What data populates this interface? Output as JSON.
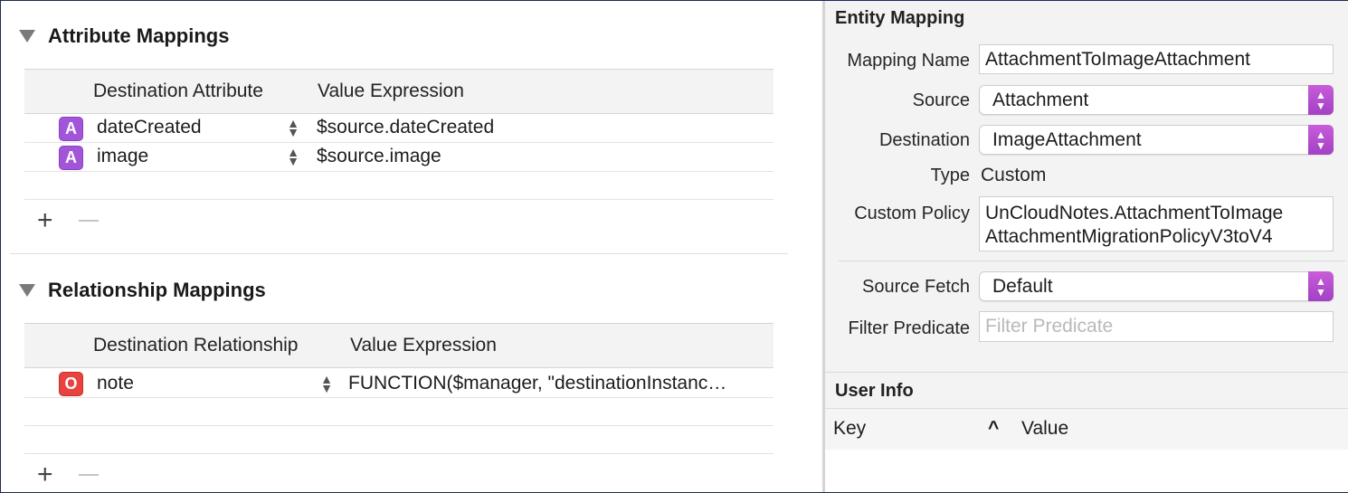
{
  "attribute_mappings": {
    "title": "Attribute Mappings",
    "columns": [
      "Destination Attribute",
      "Value Expression"
    ],
    "rows": [
      {
        "badge": "A",
        "name": "dateCreated",
        "expression": "$source.dateCreated"
      },
      {
        "badge": "A",
        "name": "image",
        "expression": "$source.image"
      }
    ],
    "add_label": "+"
  },
  "relationship_mappings": {
    "title": "Relationship Mappings",
    "columns": [
      "Destination Relationship",
      "Value Expression"
    ],
    "rows": [
      {
        "badge": "O",
        "name": "note",
        "expression": "FUNCTION($manager, \"destinationInstanc…"
      }
    ],
    "add_label": "+"
  },
  "entity_mapping": {
    "title": "Entity Mapping",
    "mapping_name_label": "Mapping Name",
    "mapping_name_value": "AttachmentToImageAttachment",
    "source_label": "Source",
    "source_value": "Attachment",
    "destination_label": "Destination",
    "destination_value": "ImageAttachment",
    "type_label": "Type",
    "type_value": "Custom",
    "custom_policy_label": "Custom Policy",
    "custom_policy_line1": "UnCloudNotes.AttachmentToImage",
    "custom_policy_line2": "AttachmentMigrationPolicyV3toV4",
    "source_fetch_label": "Source Fetch",
    "source_fetch_value": "Default",
    "filter_predicate_label": "Filter Predicate",
    "filter_predicate_placeholder": "Filter Predicate"
  },
  "user_info": {
    "title": "User Info",
    "key_column": "Key",
    "sort_indicator": "^",
    "value_column": "Value"
  },
  "colors": {
    "attribute_badge": "#a355d9",
    "relationship_badge": "#e7433f",
    "popup_accent": "#b54fcf"
  }
}
